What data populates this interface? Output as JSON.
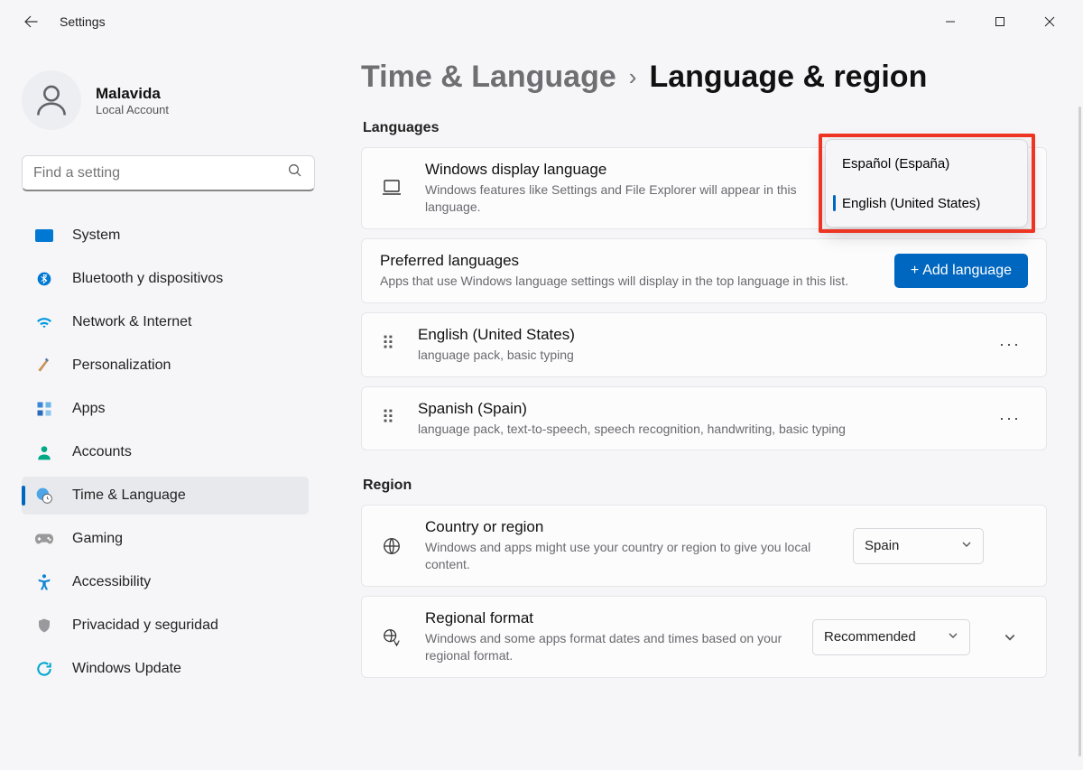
{
  "window": {
    "title": "Settings"
  },
  "account": {
    "name": "Malavida",
    "sub": "Local Account"
  },
  "search": {
    "placeholder": "Find a setting"
  },
  "nav": {
    "items": [
      {
        "label": "System"
      },
      {
        "label": "Bluetooth y dispositivos"
      },
      {
        "label": "Network & Internet"
      },
      {
        "label": "Personalization"
      },
      {
        "label": "Apps"
      },
      {
        "label": "Accounts"
      },
      {
        "label": "Time & Language"
      },
      {
        "label": "Gaming"
      },
      {
        "label": "Accessibility"
      },
      {
        "label": "Privacidad y seguridad"
      },
      {
        "label": "Windows Update"
      }
    ]
  },
  "breadcrumb": {
    "parent": "Time & Language",
    "current": "Language & region"
  },
  "sections": {
    "languages_header": "Languages",
    "region_header": "Region"
  },
  "display_language": {
    "title": "Windows display language",
    "sub": "Windows features like Settings and File Explorer will appear in this language.",
    "options": [
      {
        "label": "Español (España)"
      },
      {
        "label": "English (United States)"
      }
    ]
  },
  "preferred": {
    "title": "Preferred languages",
    "sub": "Apps that use Windows language settings will display in the top language in this list.",
    "add_label": "Add language",
    "items": [
      {
        "name": "English (United States)",
        "detail": "language pack, basic typing"
      },
      {
        "name": "Spanish (Spain)",
        "detail": "language pack, text-to-speech, speech recognition, handwriting, basic typing"
      }
    ]
  },
  "region": {
    "country_title": "Country or region",
    "country_sub": "Windows and apps might use your country or region to give you local content.",
    "country_value": "Spain",
    "format_title": "Regional format",
    "format_sub": "Windows and some apps format dates and times based on your regional format.",
    "format_value": "Recommended"
  }
}
